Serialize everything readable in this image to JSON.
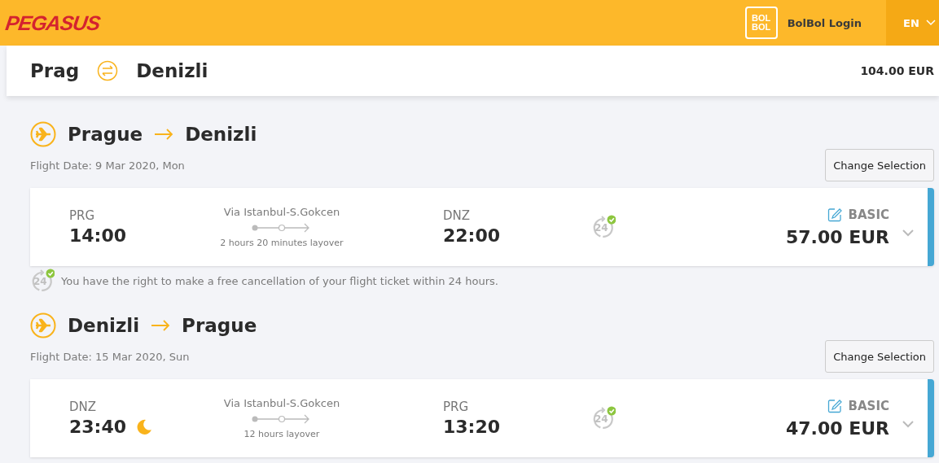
{
  "header": {
    "logo": "PEGASUS",
    "bolbol_logo": [
      "BOL",
      "BOL"
    ],
    "login": "BolBol Login",
    "language": "EN"
  },
  "summary": {
    "from": "Prag",
    "to": "Denizli",
    "total": "104.00 EUR"
  },
  "legs": [
    {
      "from": "Prague",
      "to": "Denizli",
      "date": "Flight Date: 9 Mar 2020, Mon",
      "button": "Change Selection",
      "dep_code": "PRG",
      "dep_time": "14:00",
      "night": false,
      "via": "Via Istanbul-S.Gokcen",
      "layover": "2 hours 20 minutes layover",
      "arr_code": "DNZ",
      "arr_time": "22:00",
      "badge": "24",
      "fare": "BASIC",
      "price": "57.00 EUR",
      "note": {
        "badge": "24",
        "text": "You have the right to make a free cancellation of your flight ticket within 24 hours."
      }
    },
    {
      "from": "Denizli",
      "to": "Prague",
      "date": "Flight Date: 15 Mar 2020, Sun",
      "button": "Change Selection",
      "dep_code": "DNZ",
      "dep_time": "23:40",
      "night": true,
      "via": "Via Istanbul-S.Gokcen",
      "layover": "12 hours layover",
      "arr_code": "PRG",
      "arr_time": "13:20",
      "badge": "24",
      "fare": "BASIC",
      "price": "47.00 EUR"
    }
  ]
}
